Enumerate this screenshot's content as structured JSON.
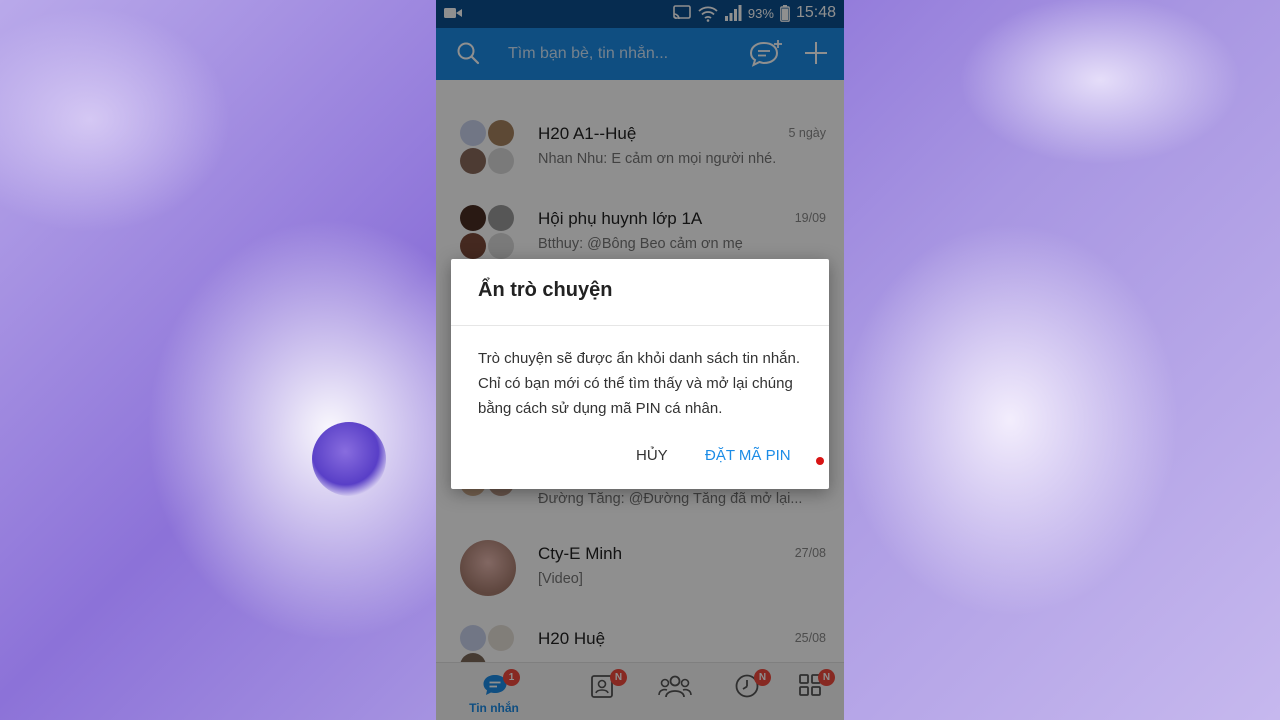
{
  "statusbar": {
    "battery": "93%",
    "time": "15:48"
  },
  "header": {
    "search_placeholder": "Tìm bạn bè, tin nhắn..."
  },
  "conversations": [
    {
      "name": "H20 A1--Huệ",
      "message": "Nhan Nhu: E cảm ơn mọi người nhé.",
      "date": "5 ngày"
    },
    {
      "name": "Hội phụ huynh lớp 1A",
      "message": "Btthuy: @Bông Beo cảm ơn mẹ",
      "date": "19/09"
    },
    {
      "name": "",
      "message": "Đường Tăng: @Đường Tăng đã mở lại...",
      "date": ""
    },
    {
      "name": "Cty-E Minh",
      "message": "[Video]",
      "date": "27/08"
    },
    {
      "name": "H20 Huệ",
      "message": "",
      "date": "25/08"
    }
  ],
  "bottom_nav": {
    "messages_label": "Tin nhắn",
    "messages_badge": "1",
    "contacts_badge": "N",
    "timeline_badge": "N",
    "more_badge": "N"
  },
  "dialog": {
    "title": "Ẩn trò chuyện",
    "body": "Trò chuyện sẽ được ẩn khỏi danh sách tin nhắn. Chỉ có bạn mới có thể tìm thấy và mở lại chúng bằng cách sử dụng mã PIN cá nhân.",
    "cancel_label": "HỦY",
    "confirm_label": "ĐẶT MÃ PIN"
  },
  "colors": {
    "accent": "#1c8ce6",
    "statusbar": "#0c4f8f",
    "badge": "#f04a3e"
  }
}
